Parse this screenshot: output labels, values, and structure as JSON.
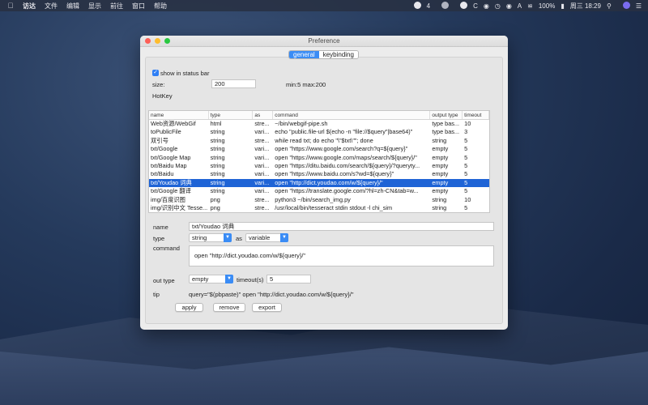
{
  "menubar": {
    "app_name": "访达",
    "items": [
      "文件",
      "编辑",
      "显示",
      "前往",
      "窗口",
      "帮助"
    ],
    "status": {
      "badge": "4",
      "letter_c": "C",
      "letter_a": "A",
      "battery": "100%",
      "datetime": "周三 18:29"
    }
  },
  "window": {
    "title": "Preference",
    "tabs": [
      {
        "label": "general",
        "active": true
      },
      {
        "label": "keybinding",
        "active": false
      }
    ]
  },
  "general": {
    "show_in_status_bar_label": "show in status bar",
    "show_in_status_bar_checked": true,
    "size_label": "size:",
    "size_value": "200",
    "size_range": "min:5 max:200",
    "hotkey_label": "HotKey"
  },
  "table": {
    "columns": [
      "name",
      "type",
      "as",
      "command",
      "output type",
      "timeout"
    ],
    "rows": [
      [
        "Web资源/WebGif",
        "html",
        "stre...",
        "~/bin/webgif-pipe.sh",
        "type bas...",
        "10"
      ],
      [
        "toPublicFile",
        "string",
        "vari...",
        "echo \"public.file-url $(echo -n \"file://$query\"|base64)\"",
        "type bas...",
        "3"
      ],
      [
        "双引号",
        "string",
        "stre...",
        "while read txt; do echo \"\\\"$txt\\\"\"; done",
        "string",
        "5"
      ],
      [
        "txt/Google",
        "string",
        "vari...",
        "open \"https://www.google.com/search?q=${query}\"",
        "empty",
        "5"
      ],
      [
        "txt/Google Map",
        "string",
        "vari...",
        "open \"https://www.google.com/maps/search/${query}/\"",
        "empty",
        "5"
      ],
      [
        "txt/Baidu Map",
        "string",
        "vari...",
        "open \"https://ditu.baidu.com/search/${query}/?queryty...",
        "empty",
        "5"
      ],
      [
        "txt/Baidu",
        "string",
        "vari...",
        "open \"https://www.baidu.com/s?wd=${query}\"",
        "empty",
        "5"
      ],
      [
        "txt/Youdao 词典",
        "string",
        "vari...",
        "open \"http://dict.youdao.com/w/${query}/\"",
        "empty",
        "5"
      ],
      [
        "txt/Google 翻译",
        "string",
        "vari...",
        "open \"https://translate.google.com/?hl=zh-CN&tab=w...",
        "empty",
        "5"
      ],
      [
        "img/百度识图",
        "png",
        "stre...",
        "python3 ~/bin/search_img.py",
        "string",
        "10"
      ],
      [
        "img/识别中文 Tesse...",
        "png",
        "stre...",
        "/usr/local/bin/tesseract stdin stdout -l chi_sim",
        "string",
        "5"
      ]
    ],
    "selected_index": 7
  },
  "detail": {
    "name_label": "name",
    "name_value": "txt/Youdao 词典",
    "type_label": "type",
    "type_value": "string",
    "as_label": "as",
    "as_value": "variable",
    "command_label": "command",
    "command_value": "open \"http://dict.youdao.com/w/${query}/\"",
    "out_type_label": "out type",
    "out_type_value": "empty",
    "timeout_label": "timeout(s)",
    "timeout_value": "5",
    "tip_label": "tip",
    "tip_value": "query=\"$(pbpaste)\" open \"http://dict.youdao.com/w/${query}/\""
  },
  "buttons": {
    "apply": "apply",
    "remove": "remove",
    "export": "export"
  },
  "colors": {
    "accent": "#3a8cf5",
    "selection": "#1f64d6"
  }
}
